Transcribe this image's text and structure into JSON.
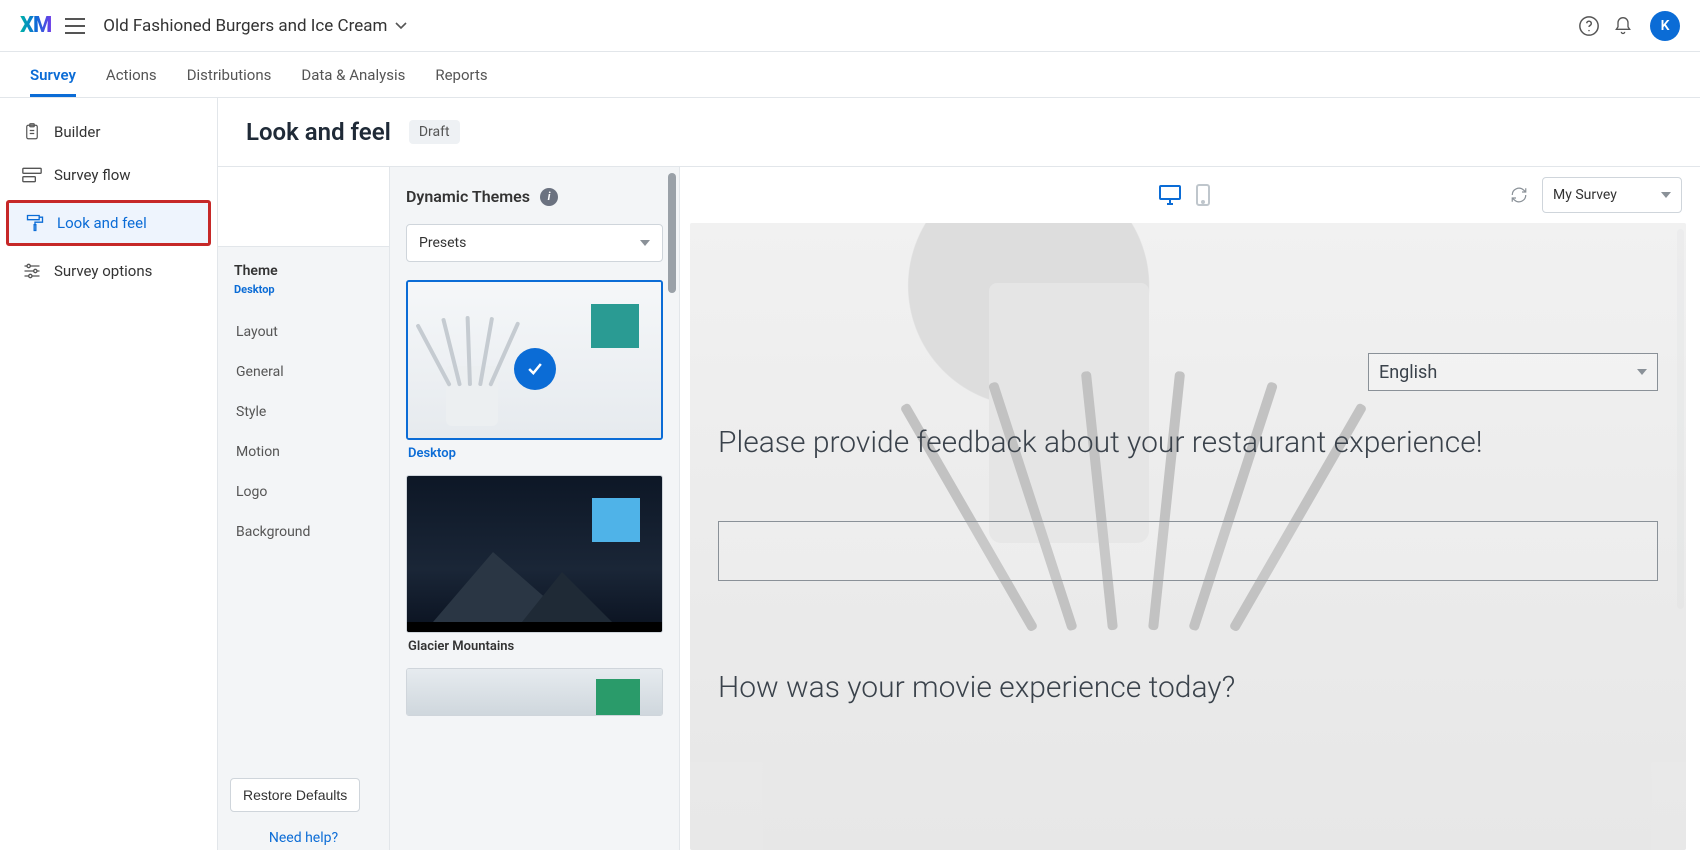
{
  "header": {
    "logo": "XM",
    "project_name": "Old Fashioned Burgers and Ice Cream",
    "avatar_initial": "K"
  },
  "main_tabs": [
    {
      "label": "Survey",
      "active": true
    },
    {
      "label": "Actions",
      "active": false
    },
    {
      "label": "Distributions",
      "active": false
    },
    {
      "label": "Data & Analysis",
      "active": false
    },
    {
      "label": "Reports",
      "active": false
    }
  ],
  "leftnav": [
    {
      "label": "Builder",
      "icon": "clipboard-icon"
    },
    {
      "label": "Survey flow",
      "icon": "flow-icon"
    },
    {
      "label": "Look and feel",
      "icon": "paint-icon",
      "active": true,
      "highlighted": true
    },
    {
      "label": "Survey options",
      "icon": "sliders-icon"
    }
  ],
  "page": {
    "title": "Look and feel",
    "status": "Draft"
  },
  "settings": {
    "section_title": "Theme",
    "section_sub": "Desktop",
    "options": [
      "Layout",
      "General",
      "Style",
      "Motion",
      "Logo",
      "Background"
    ],
    "restore_label": "Restore Defaults",
    "help_label": "Need help?"
  },
  "themes": {
    "heading": "Dynamic Themes",
    "preset_dropdown": "Presets",
    "cards": [
      {
        "label": "Desktop",
        "selected": true,
        "swatch": "#2a9b93"
      },
      {
        "label": "Glacier Mountains",
        "selected": false,
        "swatch": "#4fb3e8"
      },
      {
        "label": "",
        "selected": false,
        "swatch": "#2a9b6a"
      }
    ]
  },
  "preview": {
    "survey_dropdown": "My Survey",
    "language": "English",
    "q1": "Please provide feedback about your restaurant experience!",
    "q2": "How was your movie experience today?"
  }
}
